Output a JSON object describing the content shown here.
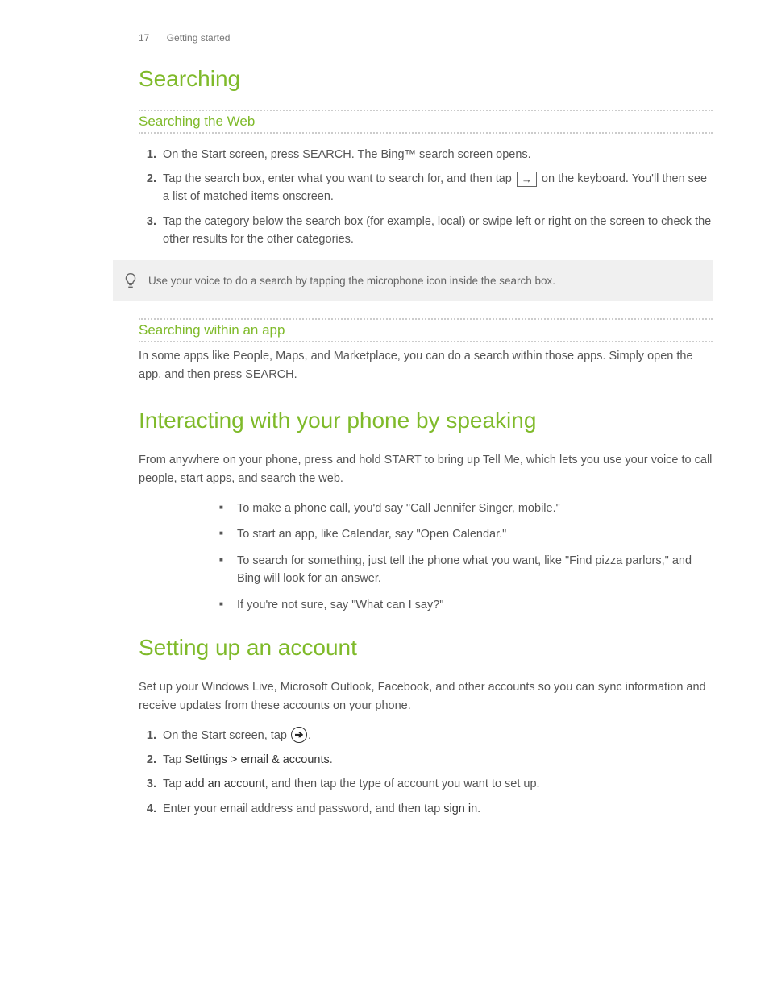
{
  "header": {
    "page_number": "17",
    "section": "Getting started"
  },
  "h1_searching": "Searching",
  "searching_web": {
    "title": "Searching the Web",
    "steps": [
      "On the Start screen, press SEARCH. The Bing™ search screen opens.",
      {
        "pre": "Tap the search box, enter what you want to search for, and then tap ",
        "icon": "go-arrow",
        "post": " on the keyboard. You'll then see a list of matched items onscreen."
      },
      "Tap the category below the search box (for example, local) or swipe left or right on the screen to check the other results for the other categories."
    ],
    "tip": "Use your voice to do a search by tapping the microphone icon inside the search box."
  },
  "searching_app": {
    "title": "Searching within an app",
    "body": "In some apps like People, Maps, and Marketplace, you can do a search within those apps. Simply open the app, and then press SEARCH."
  },
  "h1_speaking": "Interacting with your phone by speaking",
  "speaking_body": "From anywhere on your phone, press and hold START to bring up Tell Me, which lets you use your voice to call people, start apps, and search the web.",
  "speaking_bullets": [
    "To make a phone call, you'd say \"Call Jennifer Singer, mobile.\"",
    "To start an app, like Calendar, say \"Open Calendar.\"",
    "To search for something, just tell the phone what you want, like \"Find pizza parlors,\" and Bing will look for an answer.",
    "If you're not sure, say \"What can I say?\""
  ],
  "h1_account": "Setting up an account",
  "account_body": "Set up your Windows Live, Microsoft Outlook, Facebook, and other accounts so you can sync information and receive updates from these accounts on your phone.",
  "account_steps": {
    "s1_pre": "On the Start screen, tap ",
    "s1_post": ".",
    "s2_pre": "Tap ",
    "s2_bold": "Settings > email & accounts",
    "s2_post": ".",
    "s3_pre": "Tap ",
    "s3_bold": "add an account",
    "s3_post": ", and then tap the type of account you want to set up.",
    "s4_pre": "Enter your email address and password, and then tap ",
    "s4_bold": "sign in",
    "s4_post": "."
  }
}
